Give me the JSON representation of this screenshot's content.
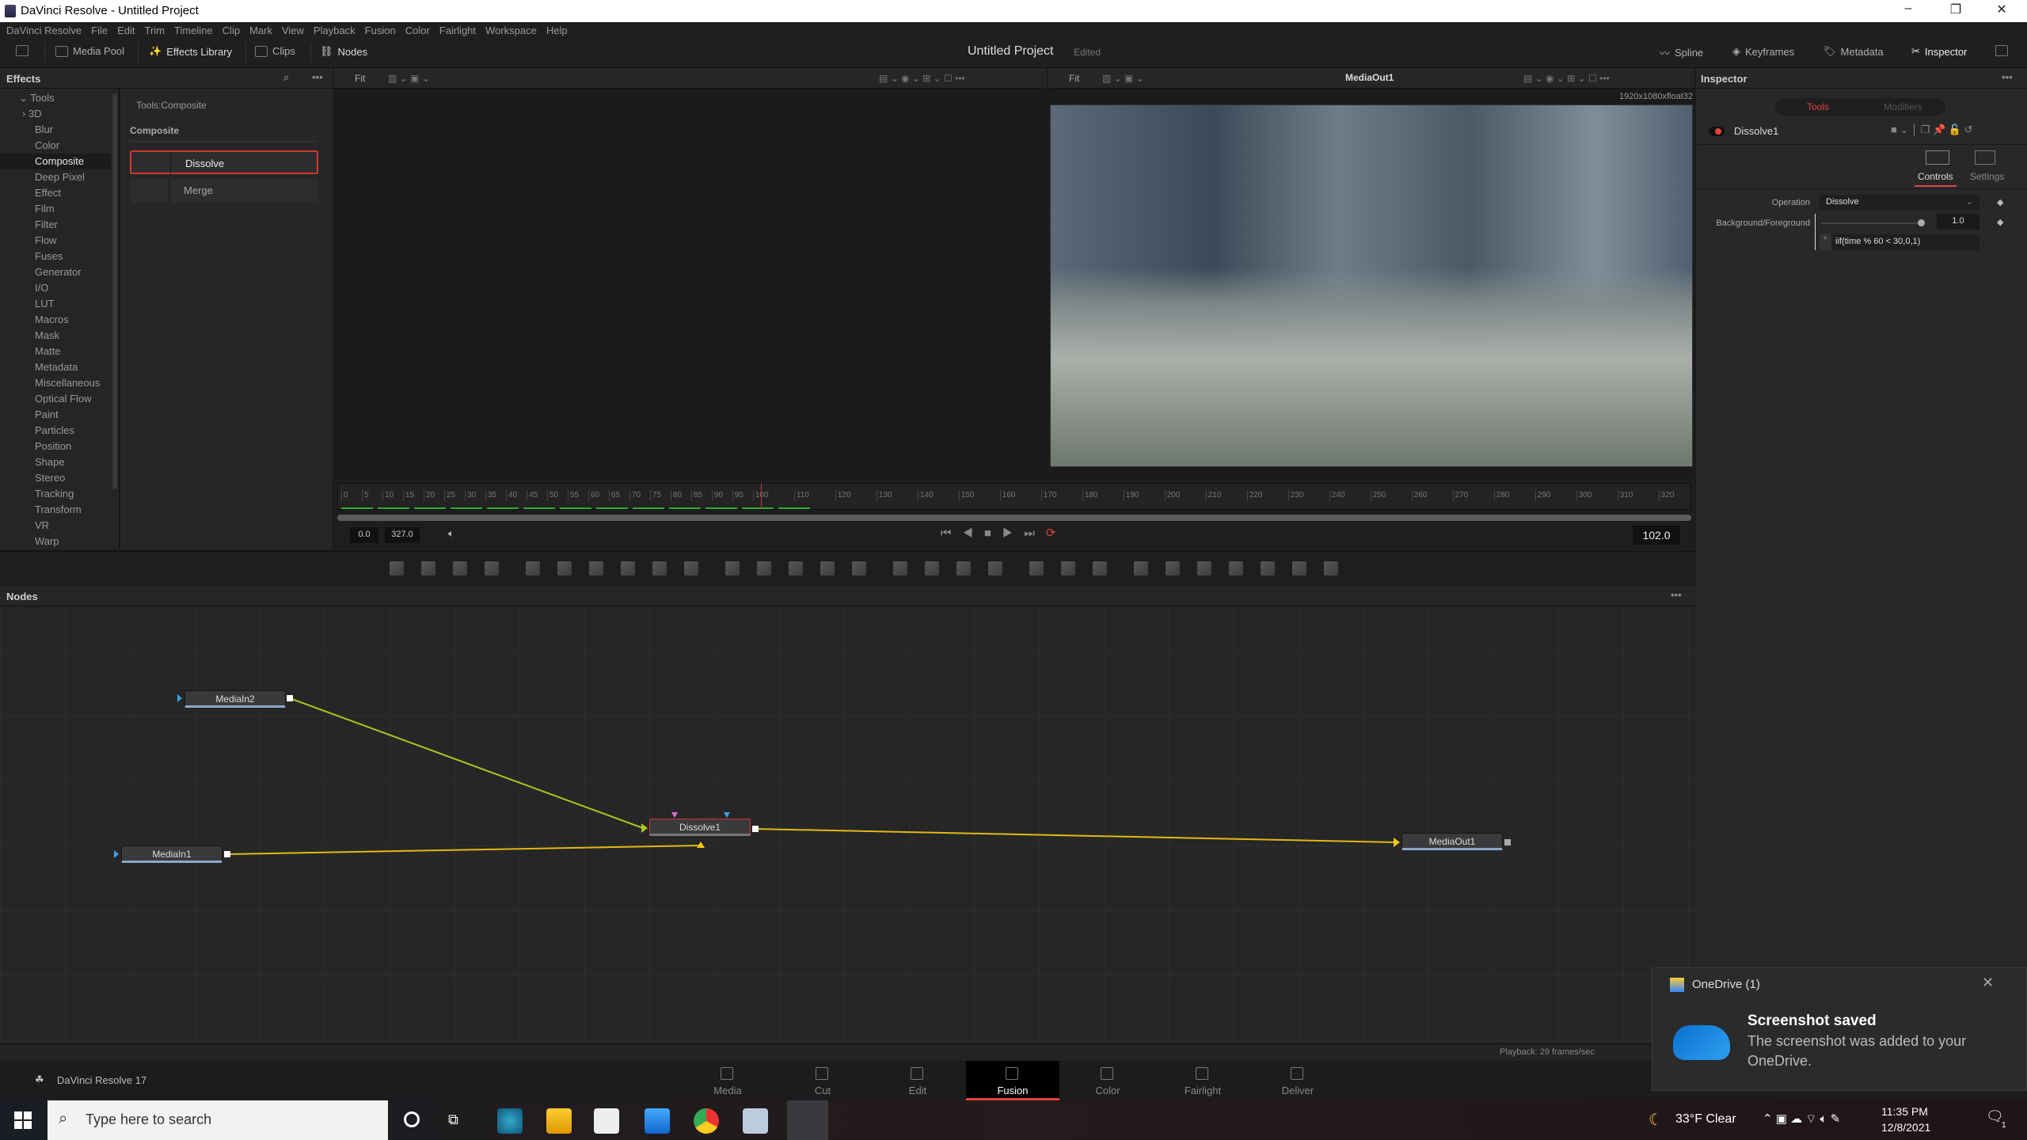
{
  "window": {
    "title": "DaVinci Resolve - Untitled Project",
    "minimize": "–",
    "maximize": "❐",
    "close": "✕"
  },
  "menu": [
    "DaVinci Resolve",
    "File",
    "Edit",
    "Trim",
    "Timeline",
    "Clip",
    "Mark",
    "View",
    "Playback",
    "Fusion",
    "Color",
    "Fairlight",
    "Workspace",
    "Help"
  ],
  "toolbar": {
    "media_pool": "Media Pool",
    "effects_library": "Effects Library",
    "clips": "Clips",
    "nodes": "Nodes",
    "project_title": "Untitled Project",
    "project_status": "Edited",
    "spline": "Spline",
    "keyframes": "Keyframes",
    "metadata": "Metadata",
    "inspector": "Inspector"
  },
  "effects": {
    "title": "Effects",
    "breadcrumb": "Tools:Composite",
    "section": "Composite",
    "tree_root": "Tools",
    "tree": [
      "3D",
      "Blur",
      "Color",
      "Composite",
      "Deep Pixel",
      "Effect",
      "Film",
      "Filter",
      "Flow",
      "Fuses",
      "Generator",
      "I/O",
      "LUT",
      "Macros",
      "Mask",
      "Matte",
      "Metadata",
      "Miscellaneous",
      "Optical Flow",
      "Paint",
      "Particles",
      "Position",
      "Shape",
      "Stereo",
      "Tracking",
      "Transform",
      "VR",
      "Warp"
    ],
    "selected": "Composite",
    "tools": [
      "Dissolve",
      "Merge"
    ]
  },
  "viewer_left": {
    "fit": "Fit"
  },
  "viewer_right": {
    "fit": "Fit",
    "title": "MediaOut1",
    "resolution": "1920x1080xfloat32"
  },
  "inspector": {
    "title": "Inspector",
    "tab_tools": "Tools",
    "tab_modifiers": "Modifiers",
    "node": "Dissolve1",
    "controls": "Controls",
    "settings": "Settings",
    "operation_label": "Operation",
    "operation_value": "Dissolve",
    "bgfg_label": "Background/Foreground",
    "bgfg_value": "1.0",
    "bgfg_fraction": 1.0,
    "expression": "iif(time % 60 < 30,0,1)",
    "accent": "#e2433b"
  },
  "timeline": {
    "start": "0.0",
    "end": "327.0",
    "current": "102.0",
    "ticks": [
      0,
      5,
      10,
      15,
      20,
      25,
      30,
      35,
      40,
      45,
      50,
      55,
      60,
      65,
      70,
      75,
      80,
      85,
      90,
      95,
      100,
      110,
      120,
      130,
      140,
      150,
      160,
      170,
      180,
      190,
      200,
      210,
      220,
      230,
      240,
      250,
      260,
      270,
      280,
      290,
      300,
      310,
      320
    ],
    "range_max": 327,
    "playhead": 102
  },
  "tool_icons": [
    "background-icon",
    "fast-noise-icon",
    "text-icon",
    "paint-icon",
    "particles-icon",
    "color-corrector-icon",
    "curves-icon",
    "hue-curves-icon",
    "brightness-icon",
    "blur-icon",
    "merge-icon",
    "channel-booleans-icon",
    "matte-control-icon",
    "resize-icon",
    "transform-icon",
    "rectangle-mask-icon",
    "ellipse-mask-icon",
    "polygon-mask-icon",
    "bspline-mask-icon",
    "tracker-icon",
    "planar-tracker-icon",
    "corner-positioner-icon",
    "shape3d-icon",
    "merge3d-icon",
    "text3d-icon",
    "camera3d-icon",
    "renderer3d-icon",
    "light3d-icon",
    "image-plane-icon"
  ],
  "nodes": {
    "title": "Nodes",
    "items": [
      "MediaIn2",
      "MediaIn1",
      "Dissolve1",
      "MediaOut1"
    ],
    "colors": {
      "background": "#c0e020",
      "foreground": "#f5c518",
      "output": "#f5c518"
    }
  },
  "status": {
    "playback": "Playback: 29 frames/sec",
    "app": "DaVinci Resolve 17"
  },
  "pages": [
    "Media",
    "Cut",
    "Edit",
    "Fusion",
    "Color",
    "Fairlight",
    "Deliver"
  ],
  "active_page": "Fusion",
  "taskbar": {
    "search_placeholder": "Type here to search",
    "weather": "33°F  Clear",
    "time": "11:35 PM",
    "date": "12/8/2021",
    "notifications": "1"
  },
  "toast": {
    "app": "OneDrive (1)",
    "title": "Screenshot saved",
    "body": "The screenshot was added to your OneDrive."
  }
}
